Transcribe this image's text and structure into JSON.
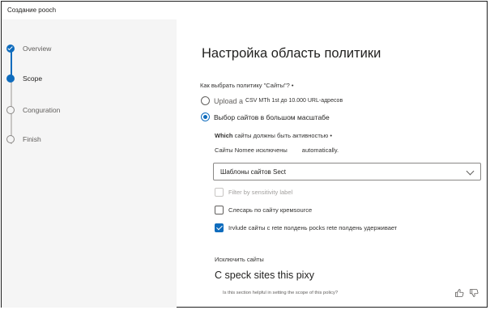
{
  "window": {
    "title": "Создание pooch"
  },
  "nav": {
    "steps": [
      {
        "label": "Overview",
        "state": "done"
      },
      {
        "label": "Scope",
        "state": "current"
      },
      {
        "label": "Conguration",
        "state": "todo"
      },
      {
        "label": "Finish",
        "state": "todo"
      }
    ]
  },
  "main": {
    "heading": "Настройка область политики",
    "question": "Как выбрать политику \"Сайты\"? •",
    "options": {
      "upload_label": "Upload a",
      "upload_detail": "CSV MTh 1st до 10.000 URL-адресов",
      "scale_label": "Выбор сайтов в большом масштабе"
    },
    "which_bold": "Which",
    "which_rest": " сайты должны быть активностью •",
    "sites_text": "Сайты Nomee исключены",
    "auto_text": "automatically.",
    "dropdown_value": "Шаблоны сайтов Sect",
    "checkboxes": {
      "filter_label": "Filter by sensitivity label",
      "fans_label": "Слесарь по сайту кремsource",
      "include_label": "Irvlude сайты с rete полдень pocks rete полдень удерживает"
    },
    "exclude_label": "Исключить сайты",
    "exclude_text": "C speck sites this pixy",
    "feedback_question": "Is this section helpful in setting the scope of this policy?"
  },
  "colors": {
    "accent": "#0f6cbd",
    "nav_background": "#f5f5f5",
    "disabled_text": "#a19f9d"
  },
  "icons": [
    "check-icon",
    "chevron-down-icon",
    "thumbs-up-icon",
    "thumbs-down-icon"
  ]
}
